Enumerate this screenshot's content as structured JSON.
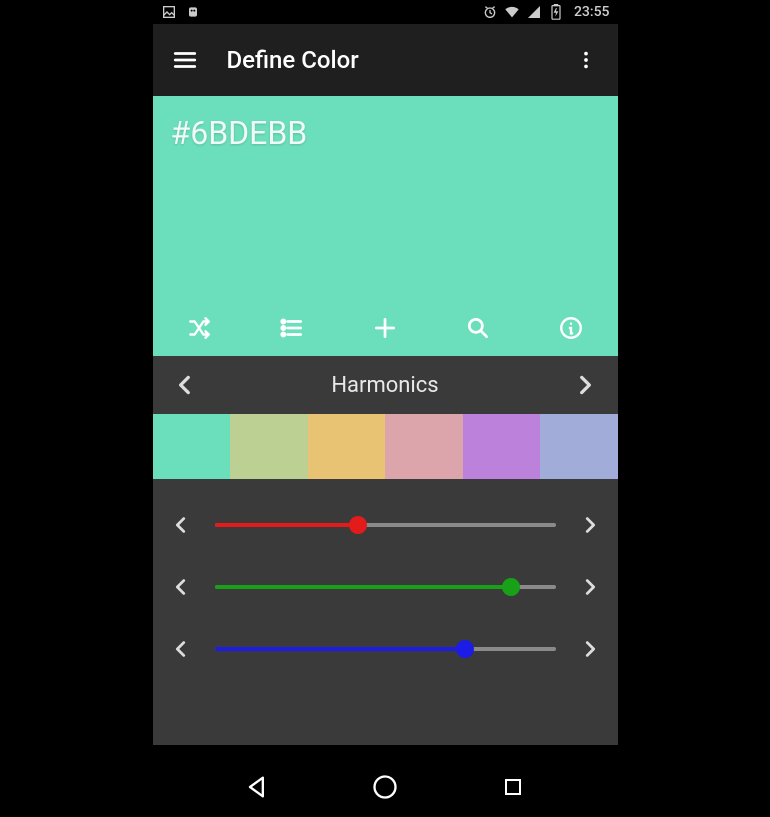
{
  "status": {
    "time": "23:55"
  },
  "header": {
    "title": "Define Color"
  },
  "color": {
    "hex": "#6BDEBB",
    "preview_bg": "#6BDEBB"
  },
  "section": {
    "title": "Harmonics"
  },
  "swatches": [
    "#6BDEBB",
    "#BCD093",
    "#E8C374",
    "#DCA4AB",
    "#BC82DB",
    "#A2ACD8"
  ],
  "channels": {
    "r": {
      "value": 107,
      "max": 255,
      "color": "#E31B1B"
    },
    "g": {
      "value": 222,
      "max": 255,
      "color": "#19A019"
    },
    "b": {
      "value": 187,
      "max": 255,
      "color": "#1C1CE6"
    }
  }
}
